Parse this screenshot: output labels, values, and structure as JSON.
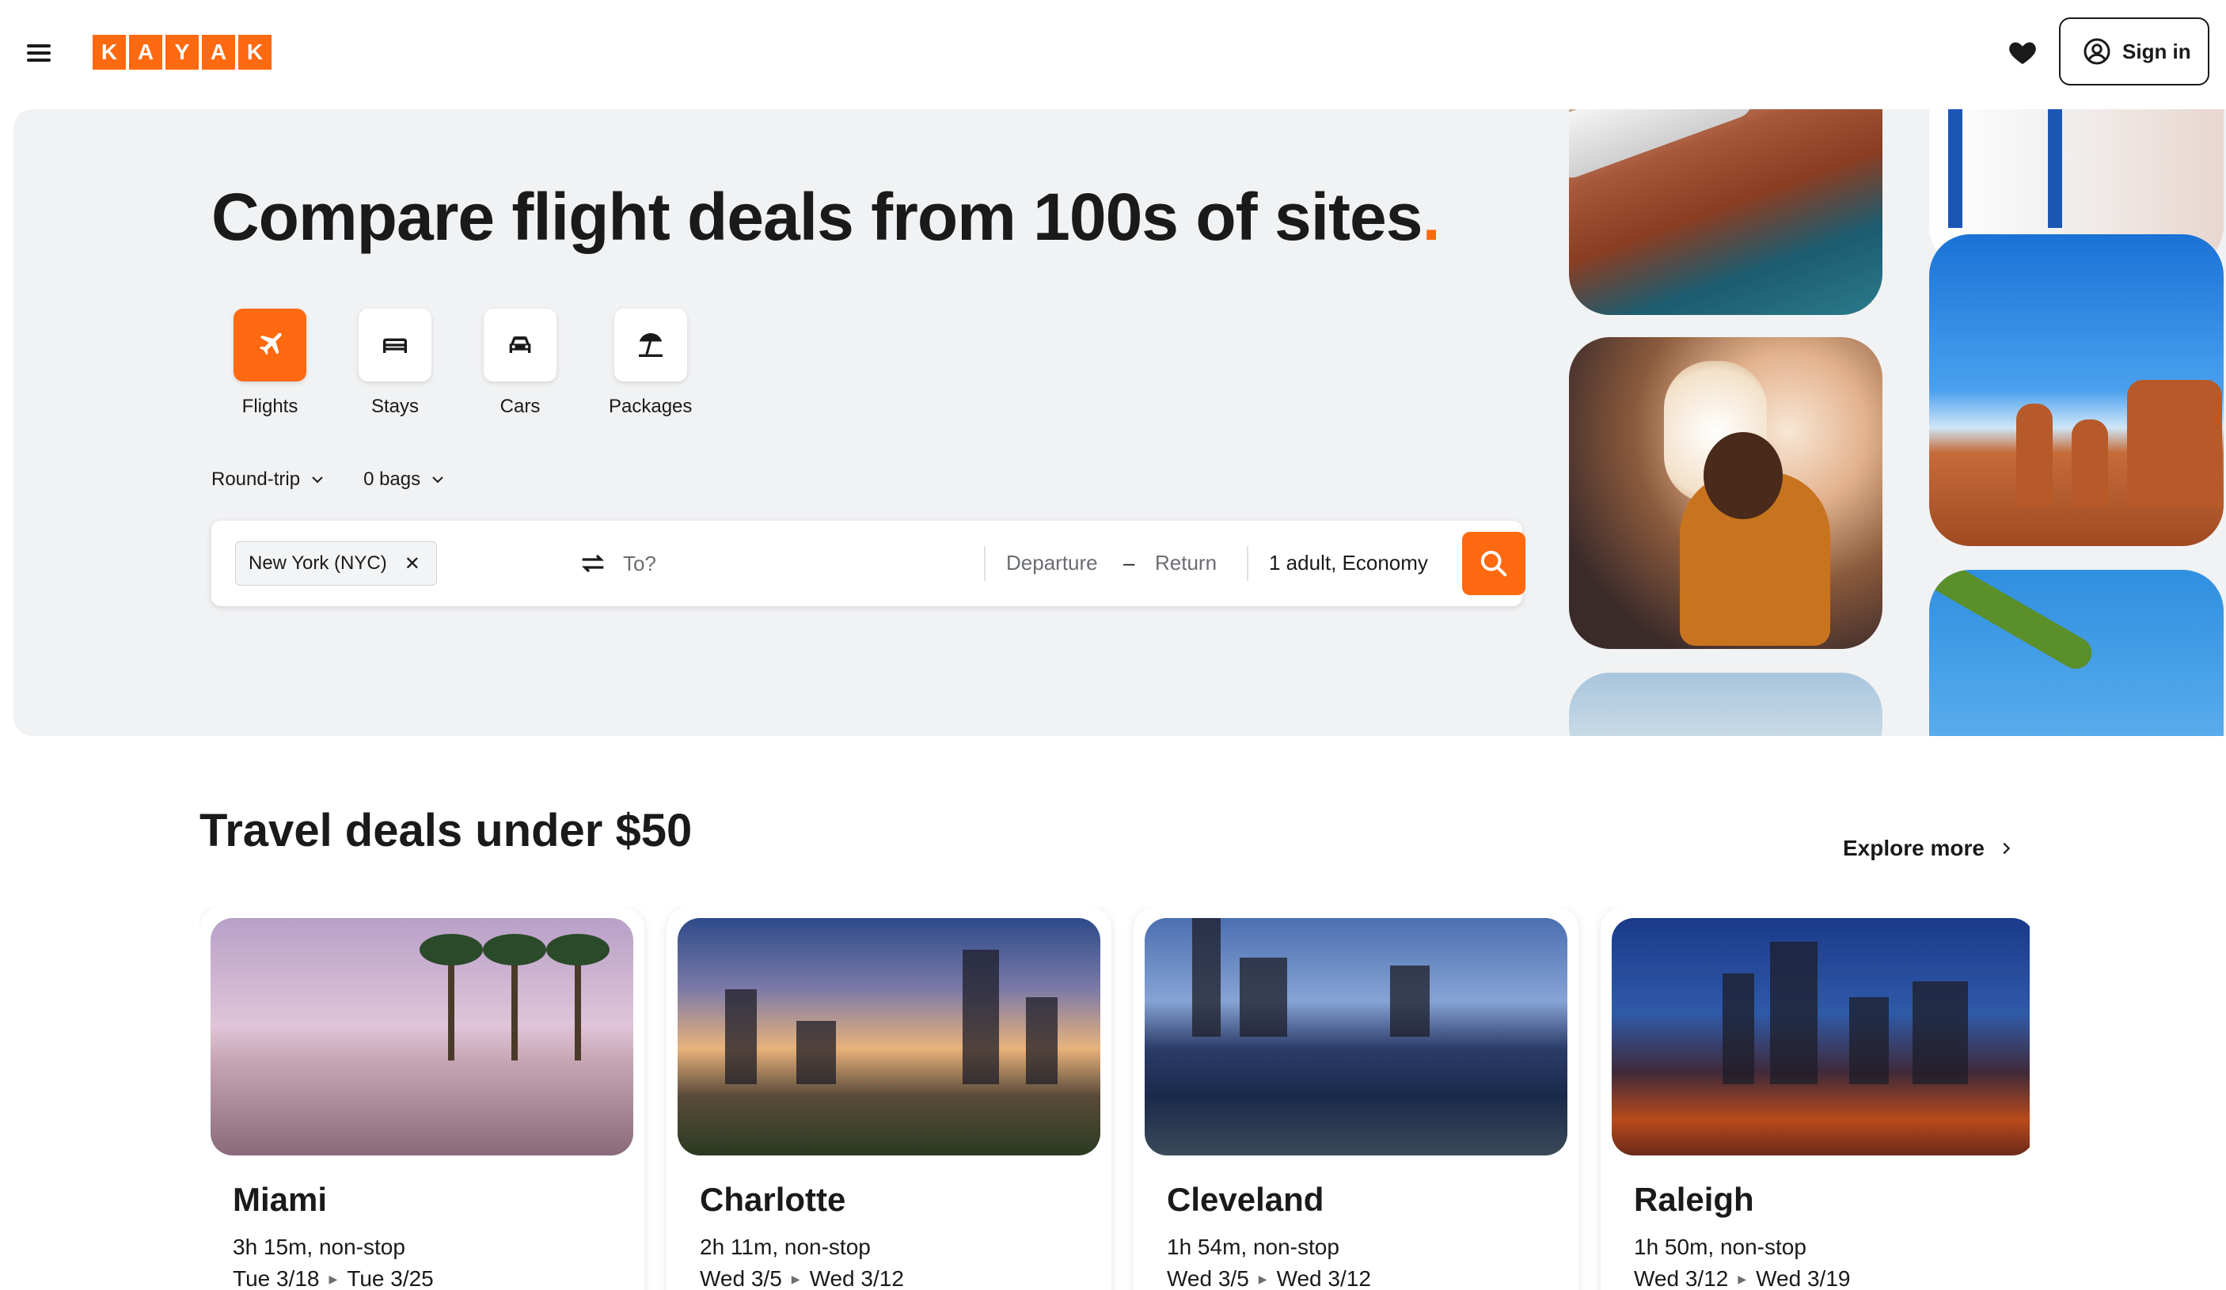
{
  "brand": {
    "logo_letters": [
      "K",
      "A",
      "Y",
      "A",
      "K"
    ],
    "accent_color": "#ff690f"
  },
  "header": {
    "signin_label": "Sign in",
    "menu_icon": "hamburger-menu-icon",
    "favorites_icon": "heart-icon",
    "account_icon": "user-circle-icon"
  },
  "hero": {
    "title": "Compare flight deals from 100s of sites",
    "title_dot": ".",
    "verticals": [
      {
        "label": "Flights",
        "icon": "airplane-icon",
        "active": true
      },
      {
        "label": "Stays",
        "icon": "bed-icon",
        "active": false
      },
      {
        "label": "Cars",
        "icon": "car-icon",
        "active": false
      },
      {
        "label": "Packages",
        "icon": "beach-umbrella-icon",
        "active": false
      }
    ],
    "options": {
      "trip_type": "Round-trip",
      "bags": "0 bags"
    },
    "search": {
      "origin": "New York (NYC)",
      "destination_placeholder": "To?",
      "departure_placeholder": "Departure",
      "date_separator": "–",
      "return_placeholder": "Return",
      "travelers": "1 adult, Economy"
    }
  },
  "deals": {
    "title": "Travel deals under $50",
    "explore_label": "Explore more",
    "items": [
      {
        "city": "Miami",
        "duration": "3h 15m, non-stop",
        "depart": "Tue 3/18",
        "return": "Tue 3/25"
      },
      {
        "city": "Charlotte",
        "duration": "2h 11m, non-stop",
        "depart": "Wed 3/5",
        "return": "Wed 3/12"
      },
      {
        "city": "Cleveland",
        "duration": "1h 54m, non-stop",
        "depart": "Wed 3/5",
        "return": "Wed 3/12"
      },
      {
        "city": "Raleigh",
        "duration": "1h 50m, non-stop",
        "depart": "Wed 3/12",
        "return": "Wed 3/19"
      }
    ]
  }
}
